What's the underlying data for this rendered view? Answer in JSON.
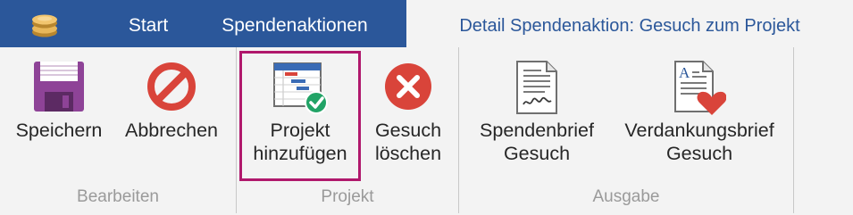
{
  "tabs": {
    "start": "Start",
    "spendenaktionen": "Spendenaktionen",
    "detail": "Detail Spendenaktion: Gesuch zum Projekt"
  },
  "groups": {
    "bearbeiten": {
      "label": "Bearbeiten",
      "buttons": {
        "speichern": "Speichern",
        "abbrechen": "Abbrechen"
      }
    },
    "projekt": {
      "label": "Projekt",
      "buttons": {
        "projekt_hinzufuegen": [
          "Projekt",
          "hinzufügen"
        ],
        "gesuch_loeschen": [
          "Gesuch",
          "löschen"
        ]
      }
    },
    "ausgabe": {
      "label": "Ausgabe",
      "buttons": {
        "spendenbrief": [
          "Spendenbrief",
          "Gesuch"
        ],
        "verdankungsbrief": [
          "Verdankungsbrief",
          "Gesuch"
        ]
      }
    }
  },
  "icons": {
    "app": "coins-icon",
    "speichern": "floppy-disk-icon",
    "abbrechen": "cancel-icon",
    "projekt_hinzufuegen": "gantt-check-icon",
    "gesuch_loeschen": "delete-x-icon",
    "spendenbrief": "signed-letter-icon",
    "verdankungsbrief": "letter-heart-icon"
  },
  "colors": {
    "tabbar": "#2b579a",
    "ribbon": "#f3f3f3",
    "highlight_border": "#b0186c",
    "floppy": "#8e4397",
    "cancel": "#d9443a",
    "check": "#21a366",
    "heart": "#d9443a"
  }
}
